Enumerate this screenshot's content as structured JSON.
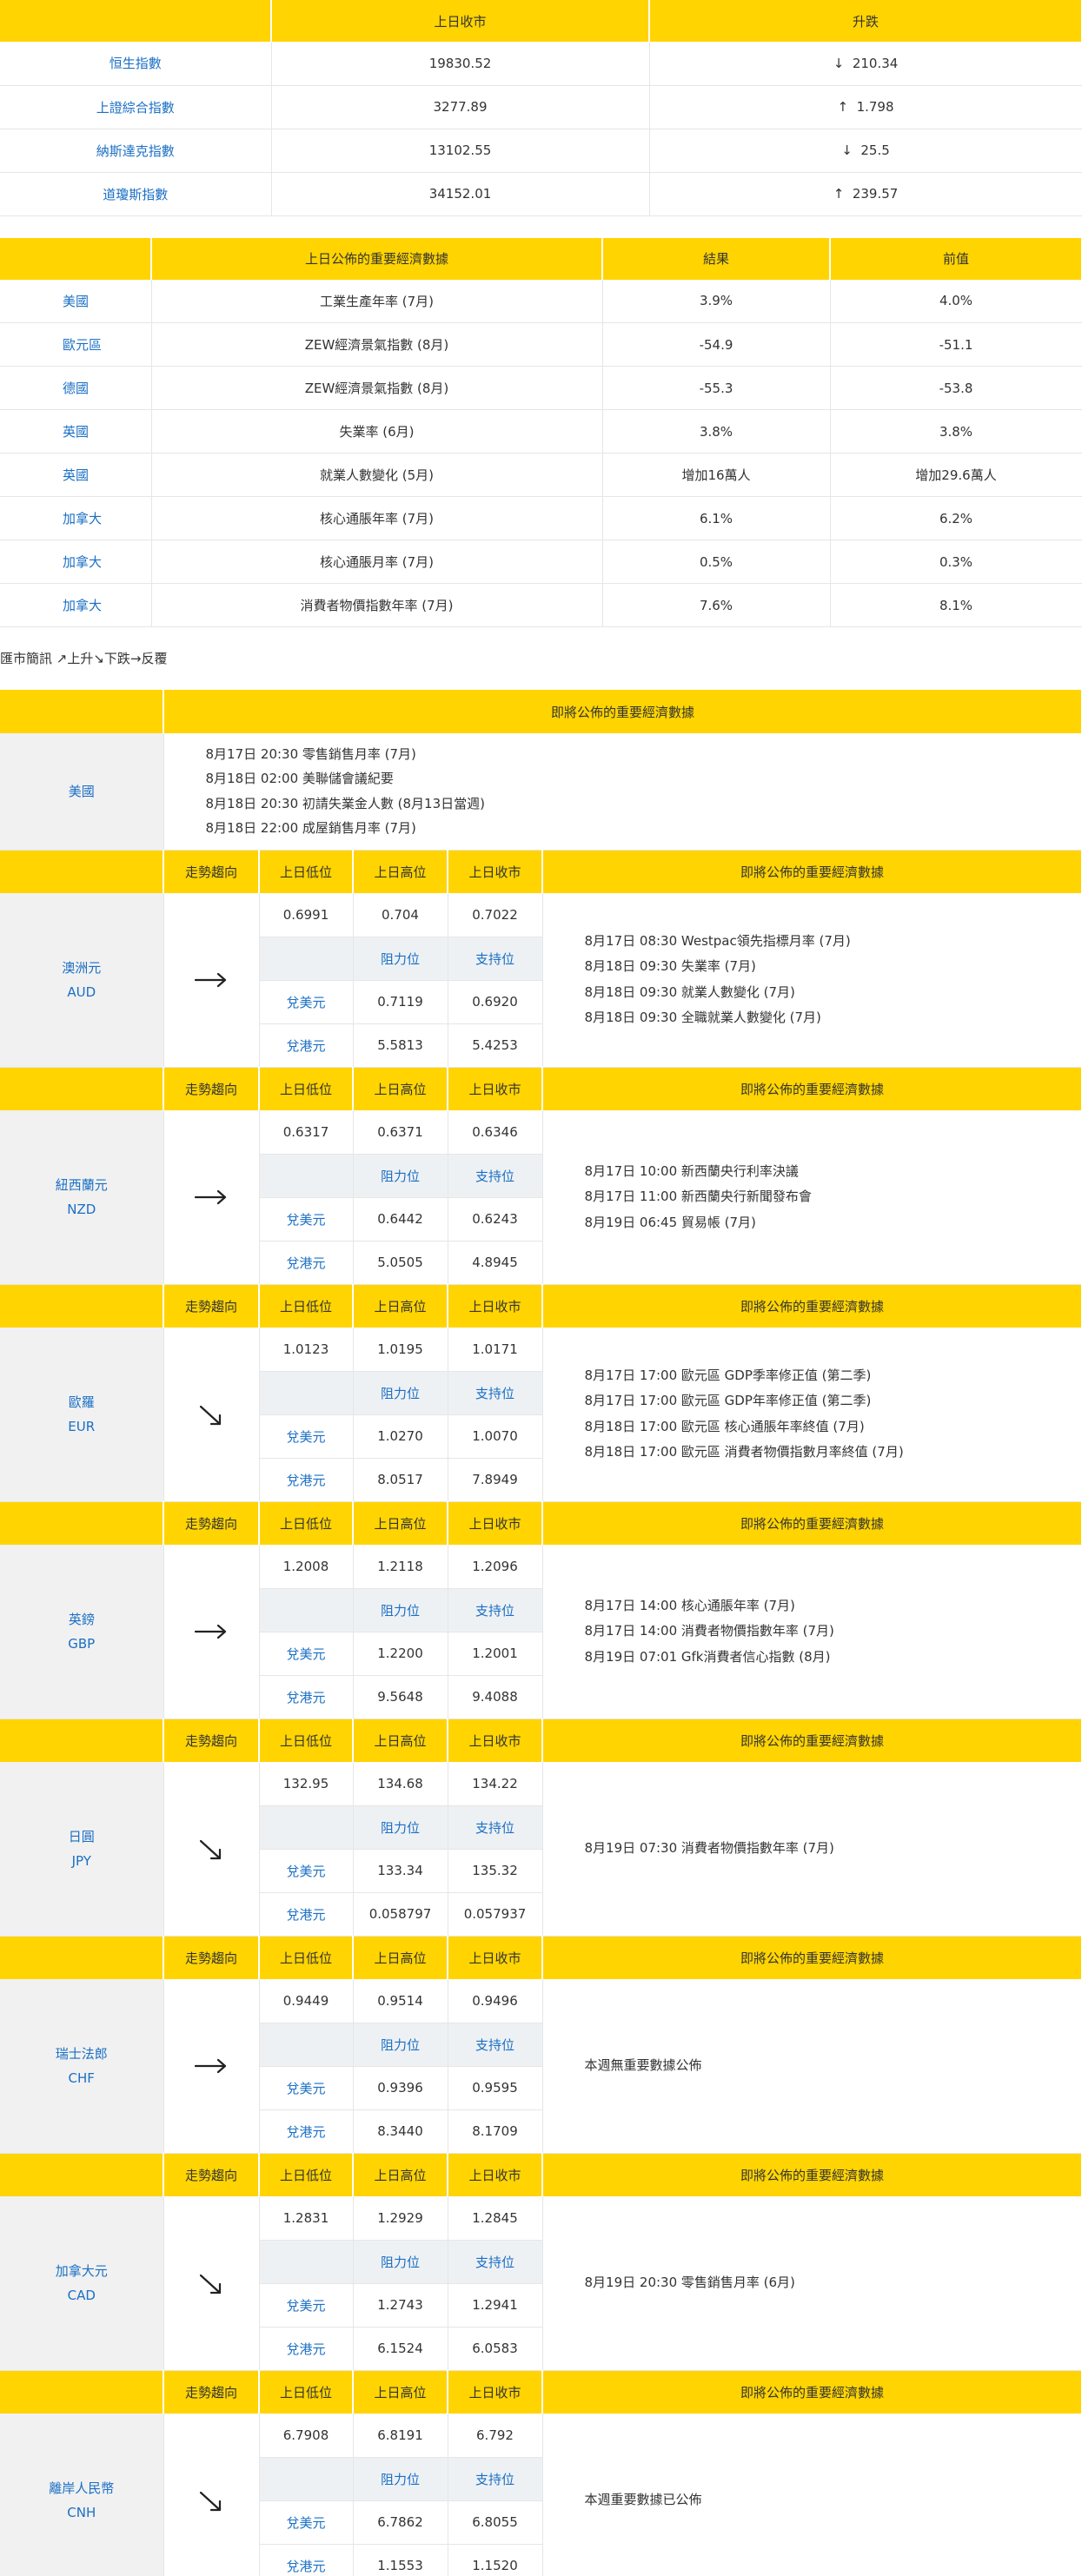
{
  "indices": {
    "headers": [
      "",
      "上日收市",
      "升跌"
    ],
    "rows": [
      {
        "name": "恒生指數",
        "close": "19830.52",
        "dir": "↓",
        "chg": "210.34"
      },
      {
        "name": "上證綜合指數",
        "close": "3277.89",
        "dir": "↑",
        "chg": "1.798"
      },
      {
        "name": "納斯達克指數",
        "close": "13102.55",
        "dir": "↓",
        "chg": "25.5"
      },
      {
        "name": "道瓊斯指數",
        "close": "34152.01",
        "dir": "↑",
        "chg": "239.57"
      }
    ]
  },
  "econ": {
    "headers": [
      "",
      "上日公佈的重要經濟數據",
      "結果",
      "前值"
    ],
    "rows": [
      {
        "country": "美國",
        "item": "工業生產年率 (7月)",
        "result": "3.9%",
        "prev": "4.0%"
      },
      {
        "country": "歐元區",
        "item": "ZEW經濟景氣指數 (8月)",
        "result": "-54.9",
        "prev": "-51.1"
      },
      {
        "country": "德國",
        "item": "ZEW經濟景氣指數 (8月)",
        "result": "-55.3",
        "prev": "-53.8"
      },
      {
        "country": "英國",
        "item": "失業率 (6月)",
        "result": "3.8%",
        "prev": "3.8%"
      },
      {
        "country": "英國",
        "item": "就業人數變化 (5月)",
        "result": "增加16萬人",
        "prev": "增加29.6萬人"
      },
      {
        "country": "加拿大",
        "item": "核心通脹年率 (7月)",
        "result": "6.1%",
        "prev": "6.2%"
      },
      {
        "country": "加拿大",
        "item": "核心通脹月率 (7月)",
        "result": "0.5%",
        "prev": "0.3%"
      },
      {
        "country": "加拿大",
        "item": "消費者物價指數年率 (7月)",
        "result": "7.6%",
        "prev": "8.1%"
      }
    ]
  },
  "note": "匯市簡訊 ↗上升↘下跌→反覆",
  "upcoming_header": "即將公佈的重要經濟數據",
  "us": {
    "country": "美國",
    "events": [
      "8月17日 20:30 零售銷售月率 (7月)",
      "8月18日 02:00 美聯儲會議紀要",
      "8月18日 20:30 初請失業金人數 (8月13日當週)",
      "8月18日 22:00 成屋銷售月率 (7月)"
    ]
  },
  "forex_headers": {
    "trend": "走勢趨向",
    "low": "上日低位",
    "high": "上日高位",
    "close": "上日收市",
    "events": "即將公佈的重要經濟數據",
    "resistance": "阻力位",
    "support": "支持位",
    "vs_usd": "兌美元",
    "vs_hkd": "兌港元"
  },
  "currencies": [
    {
      "name": "澳洲元",
      "code": "AUD",
      "trend": "sideways",
      "low": "0.6991",
      "high": "0.704",
      "close": "0.7022",
      "usd_res": "0.7119",
      "usd_sup": "0.6920",
      "hkd_res": "5.5813",
      "hkd_sup": "5.4253",
      "events": [
        "8月17日 08:30 Westpac領先指標月率 (7月)",
        "8月18日 09:30 失業率 (7月)",
        "8月18日 09:30 就業人數變化 (7月)",
        "8月18日 09:30 全職就業人數變化 (7月)"
      ]
    },
    {
      "name": "紐西蘭元",
      "code": "NZD",
      "trend": "sideways",
      "low": "0.6317",
      "high": "0.6371",
      "close": "0.6346",
      "usd_res": "0.6442",
      "usd_sup": "0.6243",
      "hkd_res": "5.0505",
      "hkd_sup": "4.8945",
      "events": [
        "8月17日 10:00 新西蘭央行利率決議",
        "8月17日 11:00 新西蘭央行新聞發布會",
        "8月19日 06:45 貿易帳 (7月)"
      ]
    },
    {
      "name": "歐羅",
      "code": "EUR",
      "trend": "down",
      "low": "1.0123",
      "high": "1.0195",
      "close": "1.0171",
      "usd_res": "1.0270",
      "usd_sup": "1.0070",
      "hkd_res": "8.0517",
      "hkd_sup": "7.8949",
      "events": [
        "8月17日 17:00 歐元區 GDP季率修正值 (第二季)",
        "8月17日 17:00 歐元區 GDP年率修正值 (第二季)",
        "8月18日 17:00 歐元區 核心通脹年率終值 (7月)",
        "8月18日 17:00 歐元區 消費者物價指數月率終值 (7月)"
      ]
    },
    {
      "name": "英鎊",
      "code": "GBP",
      "trend": "sideways",
      "low": "1.2008",
      "high": "1.2118",
      "close": "1.2096",
      "usd_res": "1.2200",
      "usd_sup": "1.2001",
      "hkd_res": "9.5648",
      "hkd_sup": "9.4088",
      "events": [
        "8月17日 14:00 核心通脹年率 (7月)",
        "8月17日 14:00 消費者物價指數年率 (7月)",
        "8月19日 07:01 Gfk消費者信心指數 (8月)"
      ]
    },
    {
      "name": "日圓",
      "code": "JPY",
      "trend": "down",
      "low": "132.95",
      "high": "134.68",
      "close": "134.22",
      "usd_res": "133.34",
      "usd_sup": "135.32",
      "hkd_res": "0.058797",
      "hkd_sup": "0.057937",
      "events": [
        "8月19日 07:30 消費者物價指數年率 (7月)"
      ]
    },
    {
      "name": "瑞士法郎",
      "code": "CHF",
      "trend": "sideways",
      "low": "0.9449",
      "high": "0.9514",
      "close": "0.9496",
      "usd_res": "0.9396",
      "usd_sup": "0.9595",
      "hkd_res": "8.3440",
      "hkd_sup": "8.1709",
      "events": [
        "本週無重要數據公佈"
      ]
    },
    {
      "name": "加拿大元",
      "code": "CAD",
      "trend": "down",
      "low": "1.2831",
      "high": "1.2929",
      "close": "1.2845",
      "usd_res": "1.2743",
      "usd_sup": "1.2941",
      "hkd_res": "6.1524",
      "hkd_sup": "6.0583",
      "events": [
        "8月19日 20:30 零售銷售月率 (6月)"
      ]
    },
    {
      "name": "離岸人民幣",
      "code": "CNH",
      "trend": "down",
      "low": "6.7908",
      "high": "6.8191",
      "close": "6.792",
      "usd_res": "6.7862",
      "usd_sup": "6.8055",
      "hkd_res": "1.1553",
      "hkd_sup": "1.1520",
      "events": [
        "本週重要數據已公佈"
      ]
    }
  ]
}
